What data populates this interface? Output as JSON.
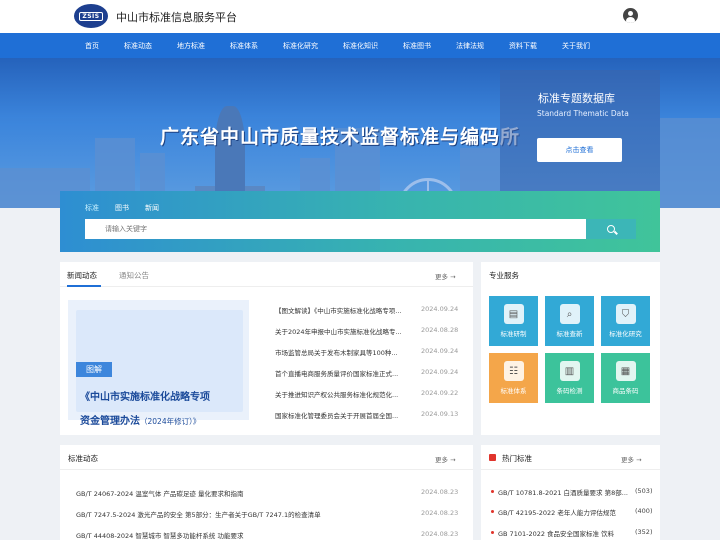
{
  "header": {
    "logo_text": "ZSIS",
    "site_title": "中山市标准信息服务平台"
  },
  "nav": [
    "首页",
    "标准动态",
    "地方标准",
    "标准体系",
    "标准化研究",
    "标准化知识",
    "标准图书",
    "法律法规",
    "资料下载",
    "关于我们"
  ],
  "banner": {
    "slogan": "广东省中山市质量技术监督标准与编码所",
    "db_title": "标准专题数据库",
    "db_subtitle": "Standard Thematic Data",
    "db_button": "点击查看"
  },
  "search": {
    "tabs": [
      "标准",
      "图书",
      "新闻"
    ],
    "placeholder": "请输入关键字"
  },
  "news": {
    "tab_news": "新闻动态",
    "tab_notice": "通知公告",
    "more": "更多",
    "image": {
      "tag": "图解",
      "line1": "《中山市实施标准化战略专项",
      "line2": "资金管理办法",
      "line2_small": "（2024年修订）》"
    },
    "items": [
      {
        "title": "【图文解读】《中山市实施标准化战略专项...",
        "date": "2024.09.24"
      },
      {
        "title": "关于2024年申报中山市实施标准化战略专...",
        "date": "2024.08.28"
      },
      {
        "title": "市场监管总局关于发布木制家具等100种...",
        "date": "2024.09.24"
      },
      {
        "title": "首个直播电商服务质量评价国家标准正式...",
        "date": "2024.09.24"
      },
      {
        "title": "关于推进知识产权公共服务标准化规范化...",
        "date": "2024.09.22"
      },
      {
        "title": "国家标准化管理委员会关于开展首届全国...",
        "date": "2024.09.13"
      }
    ]
  },
  "services": {
    "title": "专业服务",
    "items": [
      {
        "label": "标准研制",
        "color": "#32a9d6",
        "icon": "document-icon",
        "glyph": "▤"
      },
      {
        "label": "标准查新",
        "color": "#32a9d6",
        "icon": "search-doc-icon",
        "glyph": "⌕"
      },
      {
        "label": "标准化研究",
        "color": "#32a9d6",
        "icon": "shield-icon",
        "glyph": "⛉"
      },
      {
        "label": "标准体系",
        "color": "#f4a64a",
        "icon": "structure-icon",
        "glyph": "☷"
      },
      {
        "label": "条码检测",
        "color": "#3cc39b",
        "icon": "barcode-check-icon",
        "glyph": "▥"
      },
      {
        "label": "商品条码",
        "color": "#3cc39b",
        "icon": "barcode-icon",
        "glyph": "▦"
      }
    ]
  },
  "std_news": {
    "title": "标准动态",
    "more": "更多",
    "items": [
      {
        "title": "GB/T 24067-2024 温室气体 产品碳足迹 量化要求和指南",
        "date": "2024.08.23"
      },
      {
        "title": "GB/T 7247.5-2024 激光产品的安全 第5部分：生产者关于GB/T 7247.1的检查清单",
        "date": "2024.08.23"
      },
      {
        "title": "GB/T 44408-2024 智慧城市 智慧多功能杆系统 功能要求",
        "date": "2024.08.23"
      }
    ]
  },
  "hot": {
    "title": "热门标准",
    "more": "更多",
    "items": [
      {
        "title": "GB/T 10781.8-2021 白酒质量要求 第8部...",
        "count": "(503)"
      },
      {
        "title": "GB/T 42195-2022 老年人能力评估规范",
        "count": "(400)"
      },
      {
        "title": "GB 7101-2022 食品安全国家标准 饮料",
        "count": "(352)"
      }
    ]
  }
}
